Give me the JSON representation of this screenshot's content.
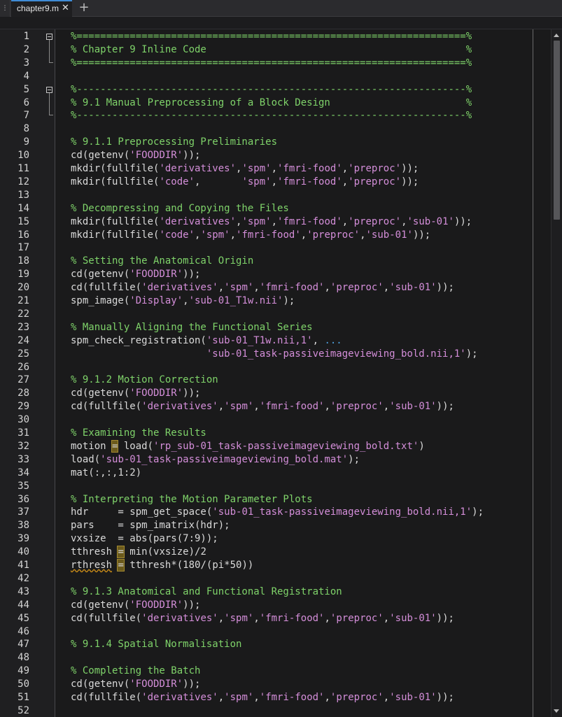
{
  "tab": {
    "title": "chapter9.m",
    "close_glyph": "✕",
    "new_glyph": "+",
    "grip_glyph": "⋮"
  },
  "icons": {
    "close": "close-icon",
    "add": "plus-icon",
    "fold": "fold-minus-icon"
  },
  "colors": {
    "comment": "#7fd36a",
    "string": "#d48ed9",
    "keyword": "#4ea1dd",
    "text": "#dadada",
    "background": "#1a1a1b",
    "tab_accent": "#3f8bd6"
  },
  "editor": {
    "line_numbers": [
      "1",
      "2",
      "3",
      "4",
      "5",
      "6",
      "7",
      "8",
      "9",
      "10",
      "11",
      "12",
      "13",
      "14",
      "15",
      "16",
      "17",
      "18",
      "19",
      "20",
      "21",
      "22",
      "23",
      "24",
      "25",
      "26",
      "27",
      "28",
      "29",
      "30",
      "31",
      "32",
      "33",
      "34",
      "35",
      "36",
      "37",
      "38",
      "39",
      "40",
      "41",
      "42",
      "43",
      "44",
      "45",
      "46",
      "47",
      "48",
      "49",
      "50",
      "51",
      "52"
    ],
    "lines": [
      [
        [
          "c",
          "%==================================================================%"
        ]
      ],
      [
        [
          "c",
          "% Chapter 9 Inline Code                                            %"
        ]
      ],
      [
        [
          "c",
          "%==================================================================%"
        ]
      ],
      [],
      [
        [
          "c",
          "%------------------------------------------------------------------%"
        ]
      ],
      [
        [
          "c",
          "% 9.1 Manual Preprocessing of a Block Design                       %"
        ]
      ],
      [
        [
          "c",
          "%------------------------------------------------------------------%"
        ]
      ],
      [],
      [
        [
          "c",
          "% 9.1.1 Preprocessing Preliminaries"
        ]
      ],
      [
        [
          "t",
          "cd(getenv("
        ],
        [
          "s",
          "'FOODDIR'"
        ],
        [
          "t",
          "));"
        ]
      ],
      [
        [
          "t",
          "mkdir(fullfile("
        ],
        [
          "s",
          "'derivatives'"
        ],
        [
          "t",
          ","
        ],
        [
          "s",
          "'spm'"
        ],
        [
          "t",
          ","
        ],
        [
          "s",
          "'fmri-food'"
        ],
        [
          "t",
          ","
        ],
        [
          "s",
          "'preproc'"
        ],
        [
          "t",
          "));"
        ]
      ],
      [
        [
          "t",
          "mkdir(fullfile("
        ],
        [
          "s",
          "'code'"
        ],
        [
          "t",
          ",       "
        ],
        [
          "s",
          "'spm'"
        ],
        [
          "t",
          ","
        ],
        [
          "s",
          "'fmri-food'"
        ],
        [
          "t",
          ","
        ],
        [
          "s",
          "'preproc'"
        ],
        [
          "t",
          "));"
        ]
      ],
      [],
      [
        [
          "c",
          "% Decompressing and Copying the Files"
        ]
      ],
      [
        [
          "t",
          "mkdir(fullfile("
        ],
        [
          "s",
          "'derivatives'"
        ],
        [
          "t",
          ","
        ],
        [
          "s",
          "'spm'"
        ],
        [
          "t",
          ","
        ],
        [
          "s",
          "'fmri-food'"
        ],
        [
          "t",
          ","
        ],
        [
          "s",
          "'preproc'"
        ],
        [
          "t",
          ","
        ],
        [
          "s",
          "'sub-01'"
        ],
        [
          "t",
          "));"
        ]
      ],
      [
        [
          "t",
          "mkdir(fullfile("
        ],
        [
          "s",
          "'code'"
        ],
        [
          "t",
          ","
        ],
        [
          "s",
          "'spm'"
        ],
        [
          "t",
          ","
        ],
        [
          "s",
          "'fmri-food'"
        ],
        [
          "t",
          ","
        ],
        [
          "s",
          "'preproc'"
        ],
        [
          "t",
          ","
        ],
        [
          "s",
          "'sub-01'"
        ],
        [
          "t",
          "));"
        ]
      ],
      [],
      [
        [
          "c",
          "% Setting the Anatomical Origin"
        ]
      ],
      [
        [
          "t",
          "cd(getenv("
        ],
        [
          "s",
          "'FOODDIR'"
        ],
        [
          "t",
          "));"
        ]
      ],
      [
        [
          "t",
          "cd(fullfile("
        ],
        [
          "s",
          "'derivatives'"
        ],
        [
          "t",
          ","
        ],
        [
          "s",
          "'spm'"
        ],
        [
          "t",
          ","
        ],
        [
          "s",
          "'fmri-food'"
        ],
        [
          "t",
          ","
        ],
        [
          "s",
          "'preproc'"
        ],
        [
          "t",
          ","
        ],
        [
          "s",
          "'sub-01'"
        ],
        [
          "t",
          "));"
        ]
      ],
      [
        [
          "t",
          "spm_image("
        ],
        [
          "s",
          "'Display'"
        ],
        [
          "t",
          ","
        ],
        [
          "s",
          "'sub-01_T1w.nii'"
        ],
        [
          "t",
          ");"
        ]
      ],
      [],
      [
        [
          "c",
          "% Manually Aligning the Functional Series"
        ]
      ],
      [
        [
          "t",
          "spm_check_registration("
        ],
        [
          "s",
          "'sub-01_T1w.nii,1'"
        ],
        [
          "t",
          ", "
        ],
        [
          "k",
          "..."
        ]
      ],
      [
        [
          "t",
          "                       "
        ],
        [
          "s",
          "'sub-01_task-passiveimageviewing_bold.nii,1'"
        ],
        [
          "t",
          ");"
        ]
      ],
      [],
      [
        [
          "c",
          "% 9.1.2 Motion Correction"
        ]
      ],
      [
        [
          "t",
          "cd(getenv("
        ],
        [
          "s",
          "'FOODDIR'"
        ],
        [
          "t",
          "));"
        ]
      ],
      [
        [
          "t",
          "cd(fullfile("
        ],
        [
          "s",
          "'derivatives'"
        ],
        [
          "t",
          ","
        ],
        [
          "s",
          "'spm'"
        ],
        [
          "t",
          ","
        ],
        [
          "s",
          "'fmri-food'"
        ],
        [
          "t",
          ","
        ],
        [
          "s",
          "'preproc'"
        ],
        [
          "t",
          ","
        ],
        [
          "s",
          "'sub-01'"
        ],
        [
          "t",
          "));"
        ]
      ],
      [],
      [
        [
          "c",
          "% Examining the Results"
        ]
      ],
      [
        [
          "t",
          "motion "
        ],
        [
          "hl",
          "="
        ],
        [
          "t",
          " load("
        ],
        [
          "s",
          "'rp_sub-01_task-passiveimageviewing_bold.txt'"
        ],
        [
          "t",
          ")"
        ]
      ],
      [
        [
          "t",
          "load("
        ],
        [
          "s",
          "'sub-01_task-passiveimageviewing_bold.mat'"
        ],
        [
          "t",
          ");"
        ]
      ],
      [
        [
          "t",
          "mat(:,:,1:2)"
        ]
      ],
      [],
      [
        [
          "c",
          "% Interpreting the Motion Parameter Plots"
        ]
      ],
      [
        [
          "t",
          "hdr     = spm_get_space("
        ],
        [
          "s",
          "'sub-01_task-passiveimageviewing_bold.nii,1'"
        ],
        [
          "t",
          ");"
        ]
      ],
      [
        [
          "t",
          "pars    = spm_imatrix(hdr);"
        ]
      ],
      [
        [
          "t",
          "vxsize  = abs(pars(7:9));"
        ]
      ],
      [
        [
          "t",
          "tthresh "
        ],
        [
          "hl",
          "="
        ],
        [
          "t",
          " min(vxsize)/2"
        ]
      ],
      [
        [
          "sq",
          "rthresh"
        ],
        [
          "t",
          " "
        ],
        [
          "hl",
          "="
        ],
        [
          "t",
          " tthresh*(180/(pi*50))"
        ]
      ],
      [],
      [
        [
          "c",
          "% 9.1.3 Anatomical and Functional Registration"
        ]
      ],
      [
        [
          "t",
          "cd(getenv("
        ],
        [
          "s",
          "'FOODDIR'"
        ],
        [
          "t",
          "));"
        ]
      ],
      [
        [
          "t",
          "cd(fullfile("
        ],
        [
          "s",
          "'derivatives'"
        ],
        [
          "t",
          ","
        ],
        [
          "s",
          "'spm'"
        ],
        [
          "t",
          ","
        ],
        [
          "s",
          "'fmri-food'"
        ],
        [
          "t",
          ","
        ],
        [
          "s",
          "'preproc'"
        ],
        [
          "t",
          ","
        ],
        [
          "s",
          "'sub-01'"
        ],
        [
          "t",
          "));"
        ]
      ],
      [],
      [
        [
          "c",
          "% 9.1.4 Spatial Normalisation"
        ]
      ],
      [],
      [
        [
          "c",
          "% Completing the Batch"
        ]
      ],
      [
        [
          "t",
          "cd(getenv("
        ],
        [
          "s",
          "'FOODDIR'"
        ],
        [
          "t",
          "));"
        ]
      ],
      [
        [
          "t",
          "cd(fullfile("
        ],
        [
          "s",
          "'derivatives'"
        ],
        [
          "t",
          ","
        ],
        [
          "s",
          "'spm'"
        ],
        [
          "t",
          ","
        ],
        [
          "s",
          "'fmri-food'"
        ],
        [
          "t",
          ","
        ],
        [
          "s",
          "'preproc'"
        ],
        [
          "t",
          ","
        ],
        [
          "s",
          "'sub-01'"
        ],
        [
          "t",
          "));"
        ]
      ],
      []
    ]
  }
}
